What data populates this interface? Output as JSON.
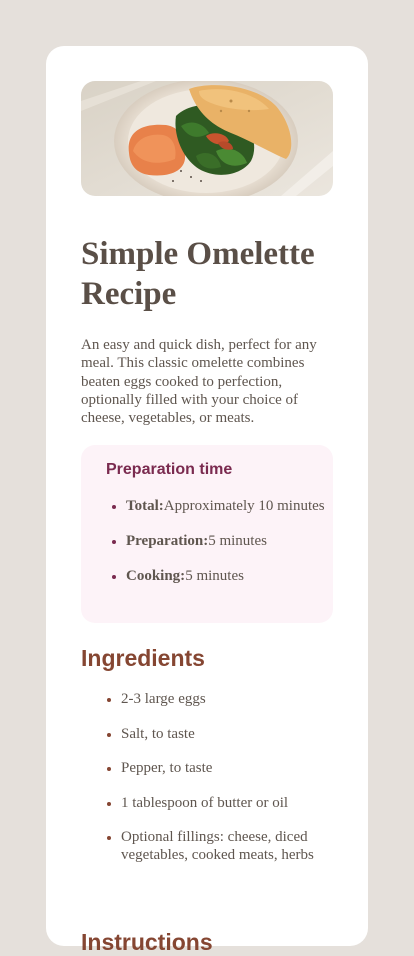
{
  "recipe": {
    "image_alt": "Omelette with spinach on a plate",
    "title": "Simple Omelette Recipe",
    "description": "An easy and quick dish, perfect for any meal. This classic omelette combines beaten eggs cooked to perfection, optionally filled with your choice of cheese, vegetables, or meats."
  },
  "preparation": {
    "heading": "Preparation time",
    "items": [
      {
        "label": "Total:",
        "value": "Approximately 10 minutes"
      },
      {
        "label": "Preparation:",
        "value": "5 minutes"
      },
      {
        "label": "Cooking:",
        "value": "5 minutes"
      }
    ]
  },
  "ingredients": {
    "heading": "Ingredients",
    "items": [
      "2-3 large eggs",
      "Salt, to taste",
      "Pepper, to taste",
      "1 tablespoon of butter or oil",
      "Optional fillings: cheese, diced vegetables, cooked meats, herbs"
    ]
  },
  "instructions": {
    "heading": "Instructions"
  },
  "colors": {
    "page_background": "#e5e0db",
    "card_background": "#ffffff",
    "heading_brown": "#854632",
    "prep_heading": "#7a2a4f",
    "prep_background": "#fdf3f8",
    "body_text": "#5f564f"
  }
}
